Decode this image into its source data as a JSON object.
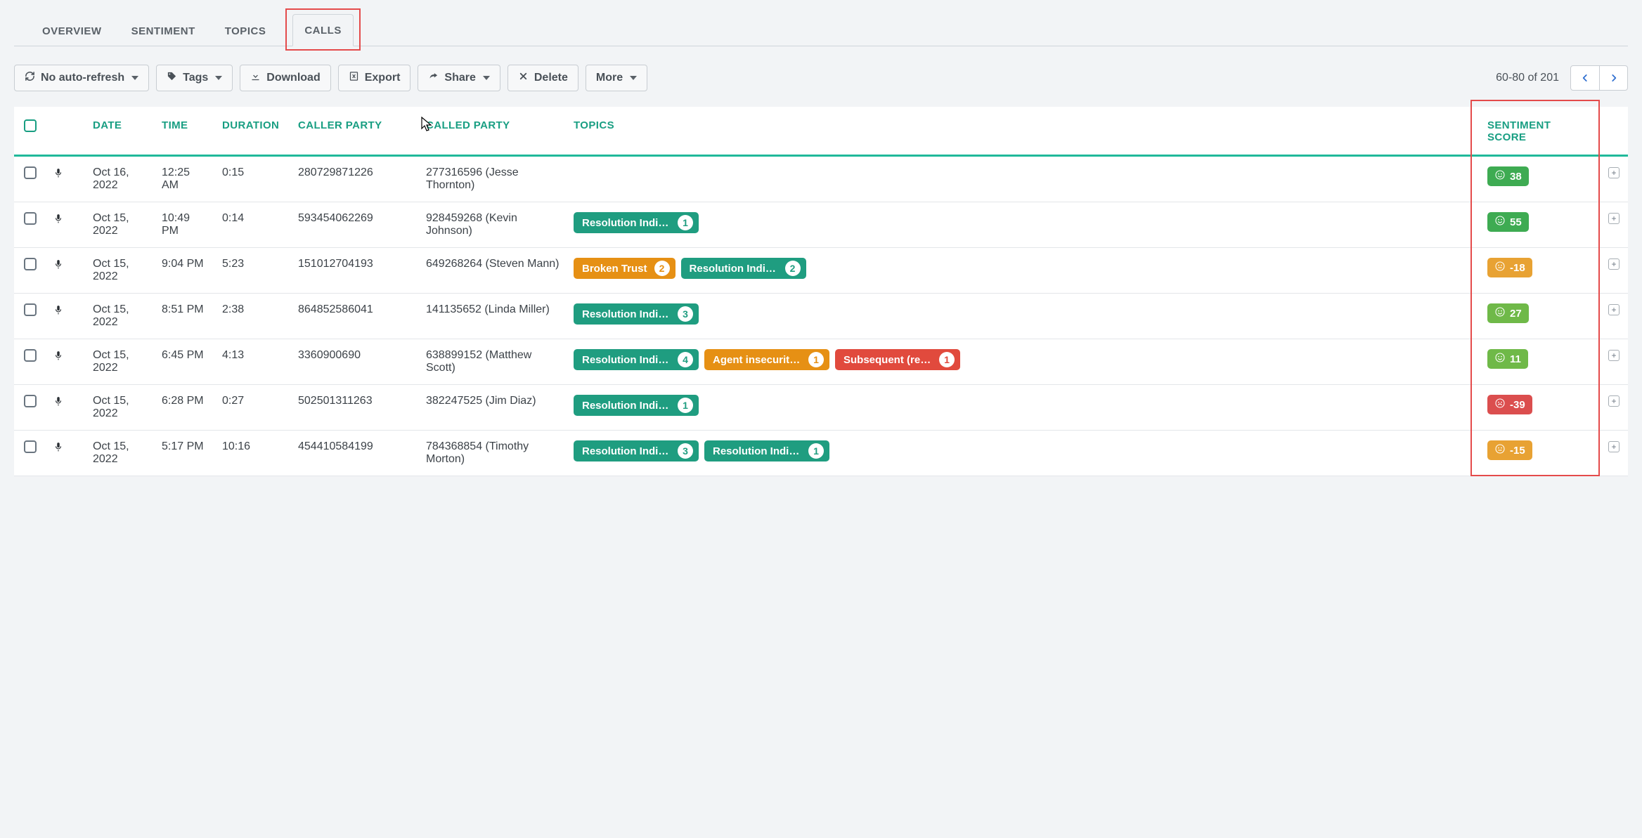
{
  "tabs": {
    "items": [
      {
        "label": "OVERVIEW",
        "active": false
      },
      {
        "label": "SENTIMENT",
        "active": false
      },
      {
        "label": "TOPICS",
        "active": false
      },
      {
        "label": "CALLS",
        "active": true
      }
    ]
  },
  "toolbar": {
    "refresh_label": "No auto-refresh",
    "tags_label": "Tags",
    "download_label": "Download",
    "export_label": "Export",
    "share_label": "Share",
    "delete_label": "Delete",
    "more_label": "More"
  },
  "pager": {
    "range": "60-80 of 201"
  },
  "columns": {
    "date": "DATE",
    "time": "TIME",
    "duration": "DURATION",
    "caller": "CALLER PARTY",
    "called": "CALLED PARTY",
    "topics": "TOPICS",
    "sentiment": "SENTIMENT SCORE"
  },
  "rows": [
    {
      "date": "Oct 16, 2022",
      "time": "12:25 AM",
      "duration": "0:15",
      "caller": "280729871226",
      "called": "277316596 (Jesse Thornton)",
      "topics": [],
      "sentiment": {
        "value": "38",
        "mood": "happy",
        "color": "sent-green"
      }
    },
    {
      "date": "Oct 15, 2022",
      "time": "10:49 PM",
      "duration": "0:14",
      "caller": "593454062269",
      "called": "928459268 (Kevin Johnson)",
      "topics": [
        {
          "label": "Resolution Indic…",
          "count": "1",
          "color": "green"
        }
      ],
      "sentiment": {
        "value": "55",
        "mood": "happy",
        "color": "sent-green"
      }
    },
    {
      "date": "Oct 15, 2022",
      "time": "9:04 PM",
      "duration": "5:23",
      "caller": "151012704193",
      "called": "649268264 (Steven Mann)",
      "topics": [
        {
          "label": "Broken Trust",
          "count": "2",
          "color": "orange"
        },
        {
          "label": "Resolution Indic…",
          "count": "2",
          "color": "green"
        }
      ],
      "sentiment": {
        "value": "-18",
        "mood": "neutral",
        "color": "sent-orange"
      }
    },
    {
      "date": "Oct 15, 2022",
      "time": "8:51 PM",
      "duration": "2:38",
      "caller": "864852586041",
      "called": "141135652 (Linda Miller)",
      "topics": [
        {
          "label": "Resolution Indic…",
          "count": "3",
          "color": "green"
        }
      ],
      "sentiment": {
        "value": "27",
        "mood": "happy",
        "color": "sent-lgreen"
      }
    },
    {
      "date": "Oct 15, 2022",
      "time": "6:45 PM",
      "duration": "4:13",
      "caller": "3360900690",
      "called": "638899152 (Matthew Scott)",
      "topics": [
        {
          "label": "Resolution Indic…",
          "count": "4",
          "color": "green"
        },
        {
          "label": "Agent insecuriti…",
          "count": "1",
          "color": "orange"
        },
        {
          "label": "Subsequent (repe…",
          "count": "1",
          "color": "red"
        }
      ],
      "sentiment": {
        "value": "11",
        "mood": "happy",
        "color": "sent-lgreen"
      }
    },
    {
      "date": "Oct 15, 2022",
      "time": "6:28 PM",
      "duration": "0:27",
      "caller": "502501311263",
      "called": "382247525 (Jim Diaz)",
      "topics": [
        {
          "label": "Resolution Indic…",
          "count": "1",
          "color": "green"
        }
      ],
      "sentiment": {
        "value": "-39",
        "mood": "sad",
        "color": "sent-red"
      }
    },
    {
      "date": "Oct 15, 2022",
      "time": "5:17 PM",
      "duration": "10:16",
      "caller": "454410584199",
      "called": "784368854 (Timothy Morton)",
      "topics": [
        {
          "label": "Resolution Indic…",
          "count": "3",
          "color": "green"
        },
        {
          "label": "Resolution Indic…",
          "count": "1",
          "color": "green"
        }
      ],
      "sentiment": {
        "value": "-15",
        "mood": "neutral",
        "color": "sent-orange"
      }
    }
  ]
}
